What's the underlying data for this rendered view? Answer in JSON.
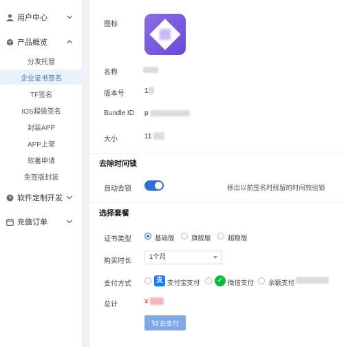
{
  "sidebar": {
    "menu": [
      {
        "label": "用户中心",
        "icon": "user-icon"
      },
      {
        "label": "产品概览",
        "icon": "cube-icon"
      },
      {
        "label": "软件定制开发",
        "icon": "dev-icon"
      },
      {
        "label": "充值订单",
        "icon": "calendar-icon"
      }
    ],
    "sub_items": [
      "分发托管",
      "企业证书签名",
      "TF签名",
      "IOS超级签名",
      "封装APP",
      "APP上架",
      "软著申请",
      "免签版封装"
    ],
    "active_sub": "企业证书签名"
  },
  "app_info": {
    "icon_label": "图标",
    "name_label": "名称",
    "version_label": "版本号",
    "version_value": "1",
    "bundle_label": "Bundle ID",
    "bundle_value": "p",
    "size_label": "大小",
    "size_value": "11"
  },
  "lock_section": {
    "title": "去除时间锁",
    "auto_label": "自动去锁",
    "auto_enabled": true,
    "hint": "移出以前签名时残留的时间效验锁"
  },
  "package_section": {
    "title": "选择套餐",
    "cert_label": "证书类型",
    "cert_options": [
      "基础版",
      "旗舰版",
      "超稳版"
    ],
    "cert_selected": "基础版",
    "duration_label": "购买时长",
    "duration_value": "1个月",
    "pay_label": "支付方式",
    "pay_options": [
      "支付宝支付",
      "微信支付",
      "余额支付"
    ],
    "total_label": "总计",
    "total_prefix": "¥",
    "pay_button": "去支付"
  },
  "colors": {
    "accent": "#2d6fd6",
    "active_bg": "#eaf1fb",
    "alipay": "#1677ff",
    "wechat": "#09b83e"
  }
}
